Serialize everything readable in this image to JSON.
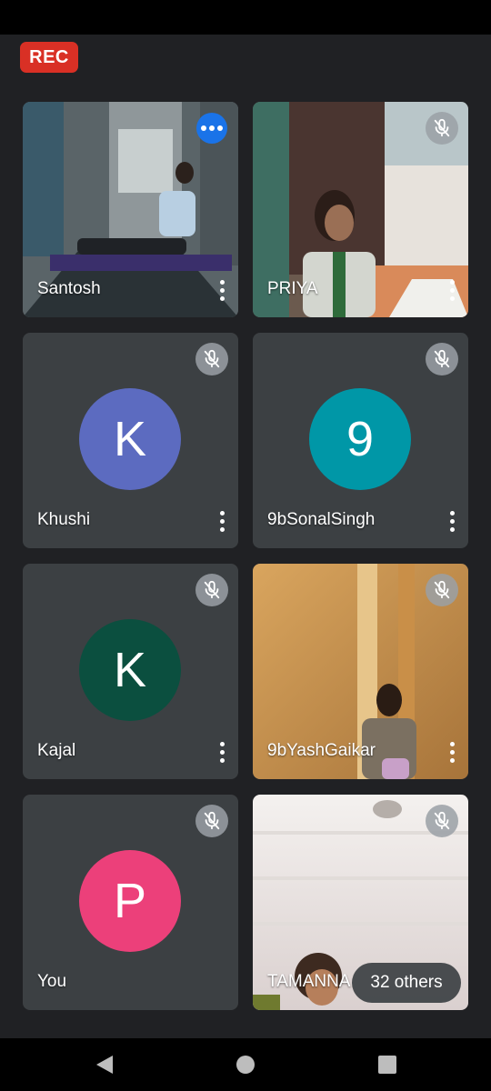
{
  "recording": {
    "label": "REC"
  },
  "tiles": [
    {
      "name": "Santosh",
      "kind": "video",
      "badge": "more-options-dots",
      "accent": "#1a73e8"
    },
    {
      "name": "PRIYA",
      "kind": "video",
      "muted": true
    },
    {
      "name": "Khushi",
      "kind": "avatar",
      "initial": "K",
      "color": "#5c6bc0",
      "muted": true
    },
    {
      "name": "9bSonalSingh",
      "kind": "avatar",
      "initial": "9",
      "color": "#0097a7",
      "muted": true
    },
    {
      "name": "Kajal",
      "kind": "avatar",
      "initial": "K",
      "color": "#0b4f3f",
      "muted": true
    },
    {
      "name": "9bYashGaikar",
      "kind": "video",
      "muted": true
    },
    {
      "name": "You",
      "kind": "avatar",
      "initial": "P",
      "color": "#ec407a",
      "muted": true
    },
    {
      "name": "TAMANNA",
      "kind": "video",
      "muted": true
    }
  ],
  "overflow": {
    "label": "32 others"
  },
  "navigation": {
    "back": "back-icon",
    "home": "home-icon",
    "recents": "recents-icon"
  }
}
